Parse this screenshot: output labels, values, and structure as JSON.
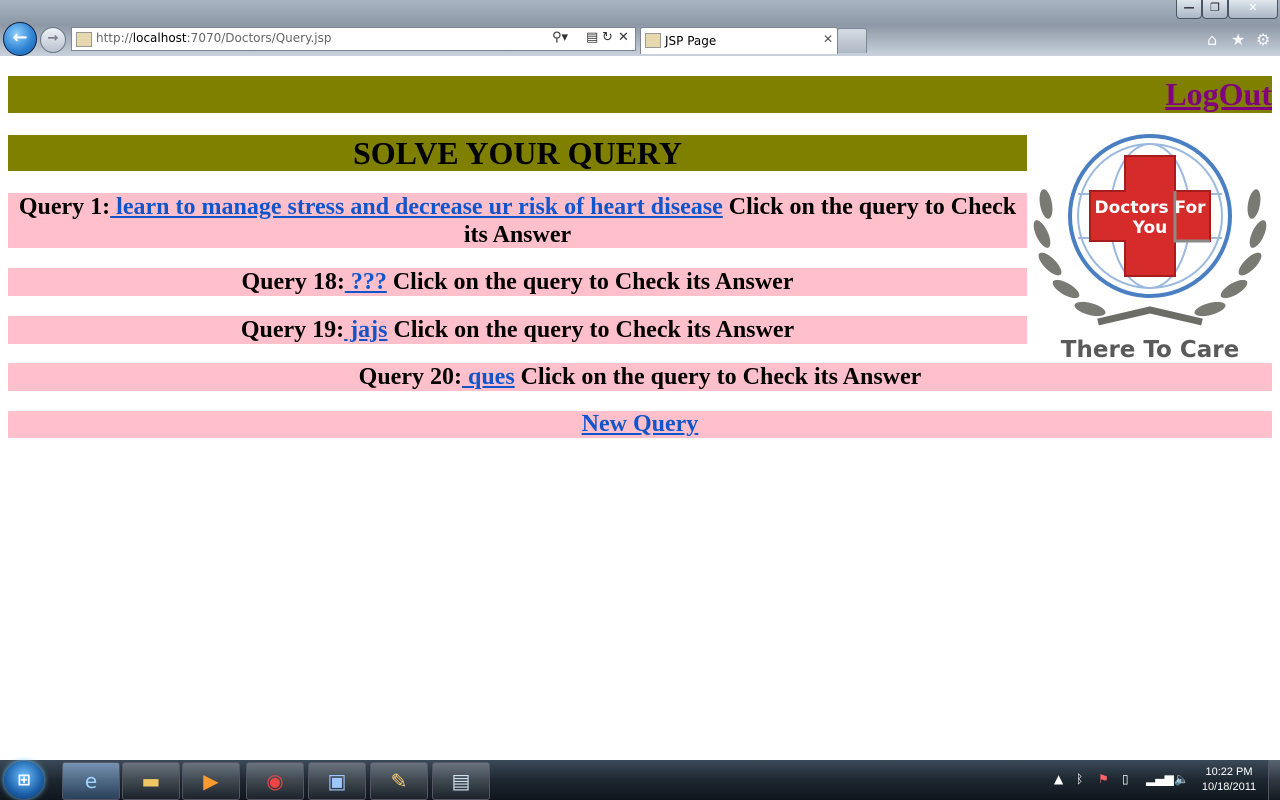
{
  "browser": {
    "url_prefix": "http://",
    "url_host": "localhost",
    "url_rest": ":7070/Doctors/Query.jsp",
    "tab_title": "JSP Page",
    "window_controls": {
      "minimize": "—",
      "maximize": "❐",
      "close": "✕"
    },
    "icons": [
      "back-arrow-icon",
      "forward-arrow-icon",
      "search-icon",
      "refresh-icon",
      "stop-icon",
      "home-icon",
      "favorites-star-icon",
      "gear-icon"
    ]
  },
  "header": {
    "logout_label": "LogOut"
  },
  "heading": "SOLVE YOUR QUERY",
  "queries": [
    {
      "label": "Query 1:",
      "link": " learn to manage stress and decrease ur risk of heart disease",
      "suffix": " Click on the query to Check its Answer"
    },
    {
      "label": "Query 18:",
      "link": " ???",
      "suffix": " Click on the query to Check its Answer"
    },
    {
      "label": "Query 19:",
      "link": " jajs",
      "suffix": " Click on the query to Check its Answer"
    },
    {
      "label": "Query 20:",
      "link": " ques",
      "suffix": " Click on the query to Check its Answer"
    }
  ],
  "new_query_label": "New Query",
  "logo": {
    "title": "Doctors For You",
    "tagline": "There To Care"
  },
  "taskbar": {
    "start_glyph": "⊞",
    "apps": [
      "internet-explorer-icon",
      "folder-icon",
      "media-player-icon",
      "chrome-icon",
      "virtualbox-icon",
      "paint-icon",
      "window-app-icon"
    ],
    "time": "10:22 PM",
    "date": "10/18/2011"
  },
  "colors": {
    "olive": "#808000",
    "pink": "#ffc0cb",
    "link": "#1155cc",
    "logout": "#800080",
    "logo_red": "#d62b2b"
  }
}
